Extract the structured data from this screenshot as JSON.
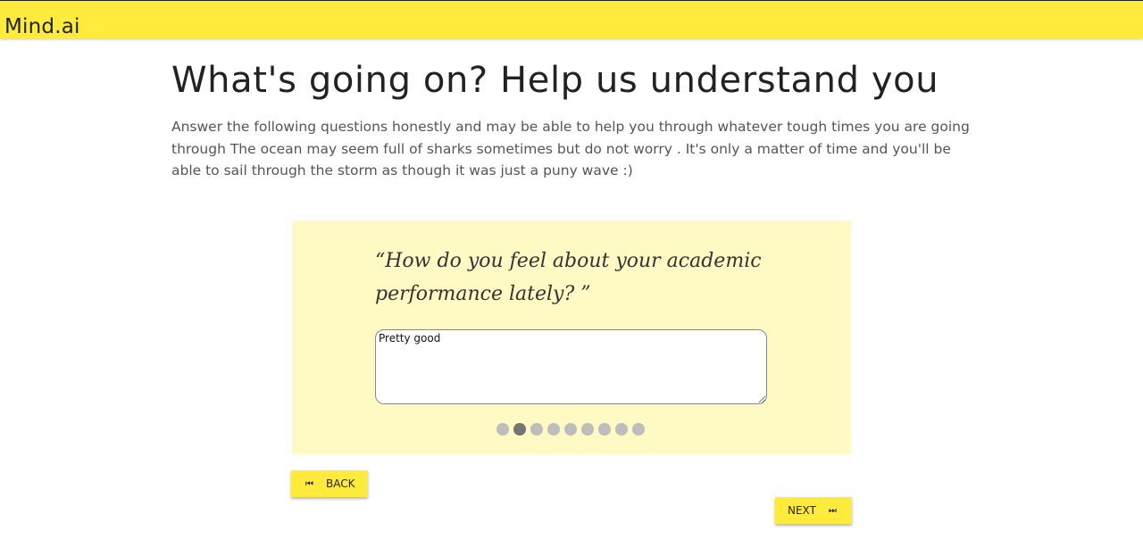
{
  "header": {
    "brand": "Mind.ai",
    "accent_color": "#ffeb3b"
  },
  "page": {
    "title": "What's going on? Help us understand you",
    "intro": "Answer the following questions honestly and may be able to help you through whatever tough times you are going through The ocean may seem full of sharks sometimes but do not worry . It's only a matter of time and you'll be able to sail through the storm as though it was just a puny wave :)"
  },
  "questionnaire": {
    "question": "“How do you feel about your academic performance lately? ”",
    "answer_value": "Pretty good",
    "card_color": "#fff9c4",
    "progress": {
      "total": 9,
      "current": 2
    }
  },
  "nav": {
    "back_label": "BACK",
    "back_icon": "skip-previous-icon",
    "next_label": "NEXT",
    "next_icon": "skip-next-icon"
  }
}
